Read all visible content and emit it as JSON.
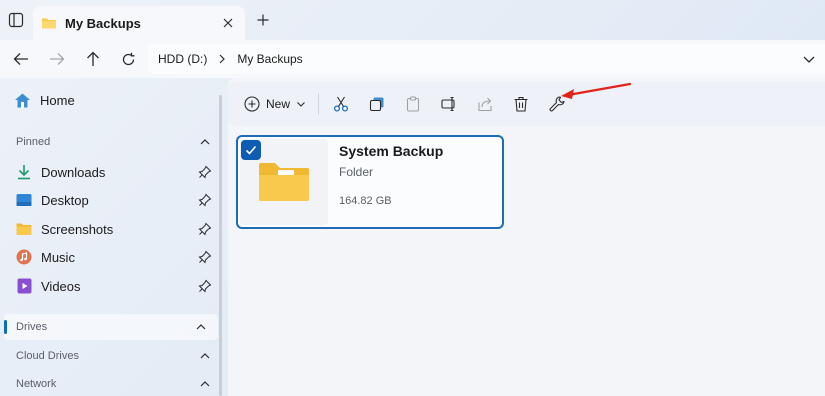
{
  "tab": {
    "title": "My Backups"
  },
  "breadcrumb": {
    "drive": "HDD (D:)",
    "folder": "My Backups"
  },
  "sidebar": {
    "home": "Home",
    "pinned_header": "Pinned",
    "pinned": [
      {
        "label": "Downloads",
        "icon": "download-icon"
      },
      {
        "label": "Desktop",
        "icon": "desktop-icon"
      },
      {
        "label": "Screenshots",
        "icon": "folder-icon"
      },
      {
        "label": "Music",
        "icon": "music-icon"
      },
      {
        "label": "Videos",
        "icon": "video-icon"
      }
    ],
    "drives_header": "Drives",
    "cloud_header": "Cloud Drives",
    "network_header": "Network"
  },
  "toolbar": {
    "new_label": "New",
    "buttons": [
      "cut-icon",
      "copy-icon",
      "paste-icon",
      "rename-icon",
      "share-icon",
      "delete-icon",
      "properties-wrench-icon"
    ]
  },
  "item": {
    "name": "System Backup",
    "type": "Folder",
    "size": "164.82 GB",
    "selected": true
  },
  "colors": {
    "accent": "#0f6cbd",
    "annotation_arrow": "#e0231b",
    "folder": "#f8c94c"
  }
}
